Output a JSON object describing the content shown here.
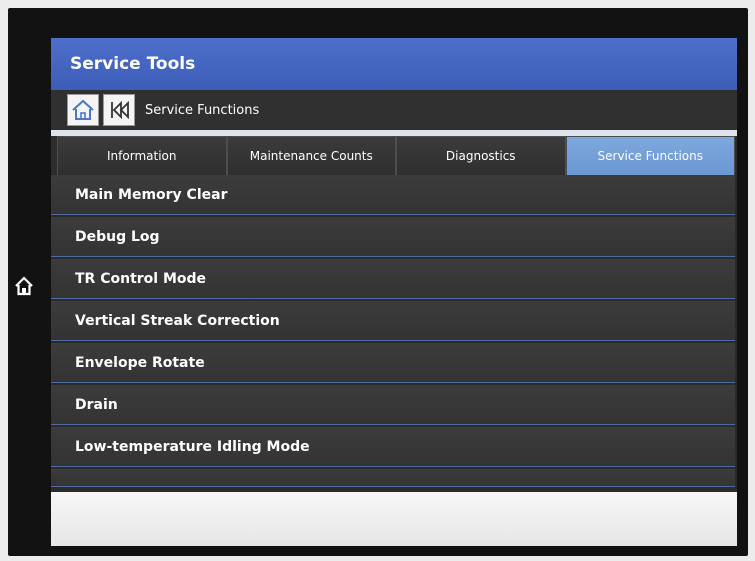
{
  "app": {
    "title": "Service Tools"
  },
  "nav": {
    "current": "Service Functions"
  },
  "tabs": [
    {
      "label": "Information",
      "active": false
    },
    {
      "label": "Maintenance Counts",
      "active": false
    },
    {
      "label": "Diagnostics",
      "active": false
    },
    {
      "label": "Service Functions",
      "active": true
    }
  ],
  "items": [
    {
      "label": "Main Memory Clear"
    },
    {
      "label": "Debug Log"
    },
    {
      "label": "TR Control Mode"
    },
    {
      "label": "Vertical Streak Correction"
    },
    {
      "label": "Envelope Rotate"
    },
    {
      "label": "Drain"
    },
    {
      "label": "Low-temperature Idling Mode"
    },
    {
      "label": ""
    }
  ],
  "icons": {
    "device_home": "home-icon",
    "nav_home": "home-icon",
    "nav_back": "back-icon"
  },
  "colors": {
    "titlebar": "#4563be",
    "active_tab": "#76a0da",
    "row": "#383838",
    "row_divider": "#4f6aa0"
  }
}
